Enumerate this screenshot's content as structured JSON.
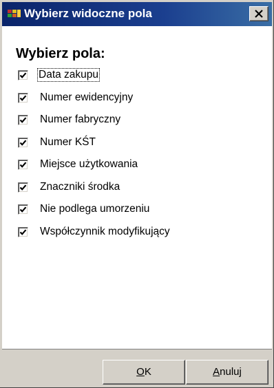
{
  "dialog": {
    "title": "Wybierz widoczne pola",
    "heading": "Wybierz pola:",
    "fields": [
      {
        "label": "Data zakupu",
        "checked": true
      },
      {
        "label": "Numer ewidencyjny",
        "checked": true
      },
      {
        "label": "Numer fabryczny",
        "checked": true
      },
      {
        "label": "Numer KŚT",
        "checked": true
      },
      {
        "label": "Miejsce użytkowania",
        "checked": true
      },
      {
        "label": "Znaczniki środka",
        "checked": true
      },
      {
        "label": "Nie podlega umorzeniu",
        "checked": true
      },
      {
        "label": "Współczynnik modyfikujący",
        "checked": true
      }
    ]
  },
  "buttons": {
    "ok": {
      "accel": "O",
      "rest": "K"
    },
    "cancel": {
      "accel": "A",
      "rest": "nuluj"
    }
  },
  "icons": {
    "app": "app-window-icon",
    "close": "close-icon",
    "check": "checkmark-icon"
  },
  "colors": {
    "titlebar": "#0a246a",
    "face": "#d4d0c8"
  }
}
